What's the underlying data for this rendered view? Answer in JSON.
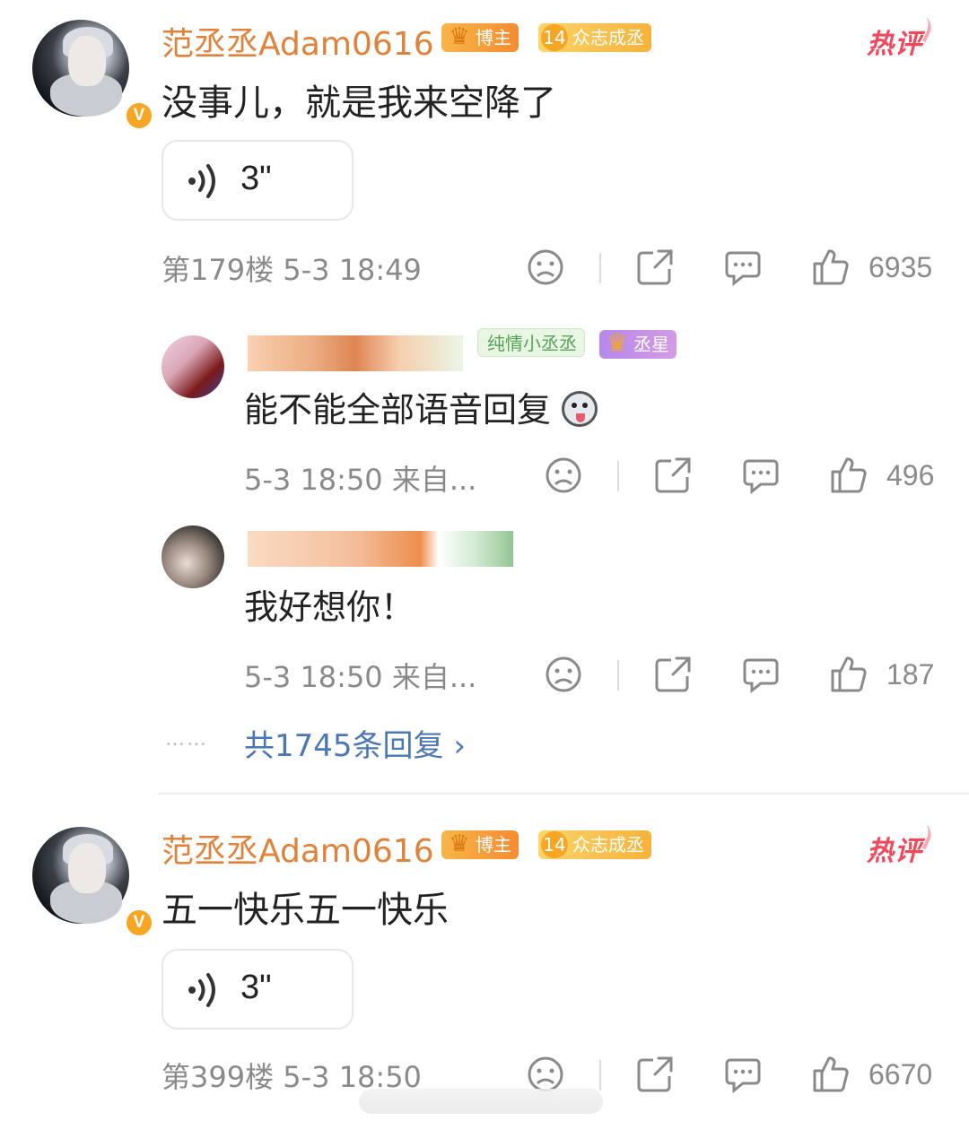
{
  "comment1": {
    "username": "范丞丞Adam0616",
    "badge_blogger": "博主",
    "badge_fan_level": "14",
    "badge_fan": "众志成丞",
    "hot_tag": "热评",
    "text": "没事儿，就是我来空降了",
    "voice_duration": "3\"",
    "floor_time": "第179楼 5-3 18:49",
    "likes": "6935"
  },
  "reply1": {
    "badge_group": "纯情小丞丞",
    "badge_star": "丞星",
    "text": "能不能全部语音回复",
    "time": "5-3 18:50 来自...",
    "likes": "496"
  },
  "reply2": {
    "text": "我好想你！",
    "time": "5-3 18:50 来自...",
    "likes": "187"
  },
  "replies_summary": {
    "dots": "……",
    "label": "共1745条回复 ›"
  },
  "comment2": {
    "username": "范丞丞Adam0616",
    "badge_blogger": "博主",
    "badge_fan_level": "14",
    "badge_fan": "众志成丞",
    "hot_tag": "热评",
    "text": "五一快乐五一快乐",
    "voice_duration": "3\"",
    "floor_time": "第399楼 5-3 18:50",
    "likes": "6670"
  },
  "icons": [
    "sad-face-icon",
    "share-icon",
    "comment-icon",
    "thumbs-up-icon"
  ],
  "colors": {
    "username": "#e0823a",
    "hot": "#f2485c",
    "link": "#4a78b5",
    "meta": "#8a8a8a"
  }
}
